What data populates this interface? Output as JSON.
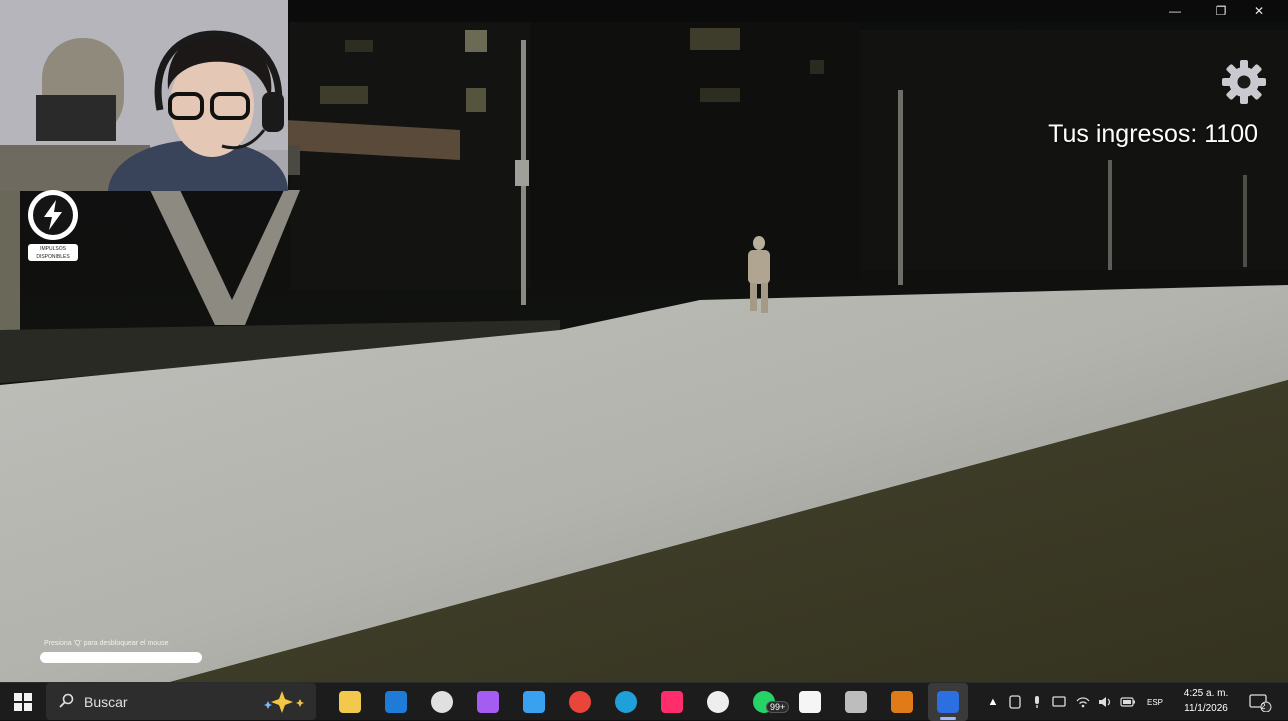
{
  "window": {
    "minimize_glyph": "—",
    "restore_glyph": "❐",
    "close_glyph": "✕"
  },
  "hud": {
    "income_label": "Tus ingresos: 1100",
    "boost_label": "IMPULSOS DISPONIBLES",
    "unlock_hint": "Presiona 'Q' para desbloquear el mouse",
    "settings_icon": "gear-icon",
    "boost_icon": "lightning-bolt-icon"
  },
  "taskbar": {
    "start_icon": "windows-start-icon",
    "search_placeholder": "Buscar",
    "apps": [
      {
        "name": "file-explorer-icon",
        "color": "#f2c94c"
      },
      {
        "name": "mail-icon",
        "color": "#1e7cd8"
      },
      {
        "name": "clipchamp-icon",
        "color": "#e0e0e0"
      },
      {
        "name": "copilot-icon",
        "color": "#a45cf2"
      },
      {
        "name": "microsoft-store-icon",
        "color": "#3aa0f0"
      },
      {
        "name": "chrome-icon",
        "color": "#e9453b"
      },
      {
        "name": "edge-icon",
        "color": "#1fa0d8"
      },
      {
        "name": "tiktok-icon",
        "color": "#ff2d6b"
      },
      {
        "name": "app-icon",
        "color": "#eeeeee"
      },
      {
        "name": "whatsapp-icon",
        "color": "#25d366",
        "badge": "99+"
      },
      {
        "name": "notepad-icon",
        "color": "#f5f5f5"
      },
      {
        "name": "app-window-icon",
        "color": "#bdbdbd"
      },
      {
        "name": "game-icon",
        "color": "#e07b1a"
      },
      {
        "name": "roblox-icon",
        "color": "#2c6fe0"
      }
    ],
    "tray": {
      "language": "ESP",
      "time": "4:25 a. m.",
      "date": "11/1/2026",
      "notifications": "2"
    }
  }
}
